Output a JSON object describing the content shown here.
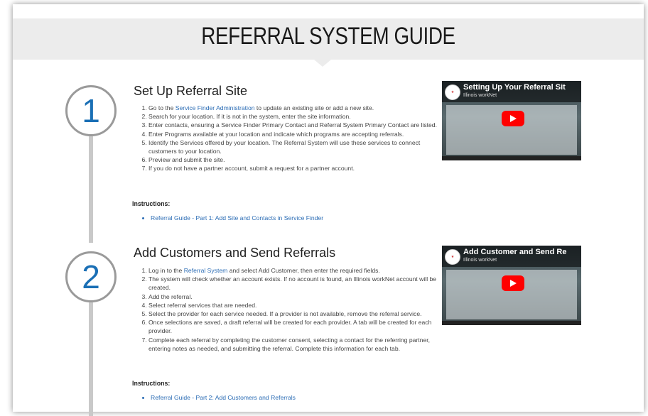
{
  "banner": {
    "title": "REFERRAL SYSTEM GUIDE"
  },
  "steps": [
    {
      "number": "1",
      "title": "Set Up Referral Site",
      "items": [
        {
          "pre": "Go to the ",
          "link": "Service Finder Administration",
          "post": " to update an existing site or add a new site."
        },
        {
          "pre": "Search for your location. If it is not in the system, enter the site information.",
          "link": "",
          "post": ""
        },
        {
          "pre": "Enter contacts, ensuring a Service Finder Primary Contact and Referral System Primary Contact are listed.",
          "link": "",
          "post": ""
        },
        {
          "pre": "Enter Programs available at your location and indicate which programs are accepting referrals.",
          "link": "",
          "post": ""
        },
        {
          "pre": "Identify the Services offered by your location. The Referral System will use these services to connect customers to your location.",
          "link": "",
          "post": ""
        },
        {
          "pre": "Preview and submit the site.",
          "link": "",
          "post": ""
        },
        {
          "pre": "If you do not have a partner account, submit a request for a partner account.",
          "link": "",
          "post": ""
        }
      ],
      "instructions_label": "Instructions:",
      "instruction_links": [
        "Referral Guide - Part 1: Add Site and Contacts in Service Finder"
      ],
      "video": {
        "title": "Setting Up Your Referral Sit",
        "channel": "Illinois workNet"
      }
    },
    {
      "number": "2",
      "title": "Add Customers and Send Referrals",
      "items": [
        {
          "pre": "Log in to the ",
          "link": "Referral System",
          "post": " and select Add Customer, then enter the required fields."
        },
        {
          "pre": "The system will check whether an account exists. If no account is found, an Illinois workNet account will be created.",
          "link": "",
          "post": ""
        },
        {
          "pre": "Add the referral.",
          "link": "",
          "post": ""
        },
        {
          "pre": "Select referral services that are needed.",
          "link": "",
          "post": ""
        },
        {
          "pre": "Select the provider for each service needed. If a provider is not available, remove the referral service.",
          "link": "",
          "post": ""
        },
        {
          "pre": "Once selections are saved, a draft referral will be created for each provider. A tab will be created for each provider.",
          "link": "",
          "post": ""
        },
        {
          "pre": "Complete each referral by completing the customer consent, selecting a contact for the referring partner, entering notes as needed, and submitting the referral. Complete this information for each tab.",
          "link": "",
          "post": ""
        }
      ],
      "instructions_label": "Instructions:",
      "instruction_links": [
        "Referral Guide - Part 2: Add Customers and Referrals"
      ],
      "video": {
        "title": "Add Customer and Send Re",
        "channel": "Illinois workNet"
      }
    }
  ],
  "colors": {
    "accent": "#2c6db5",
    "banner_bg": "#ececec",
    "number": "#1a6fb5"
  }
}
